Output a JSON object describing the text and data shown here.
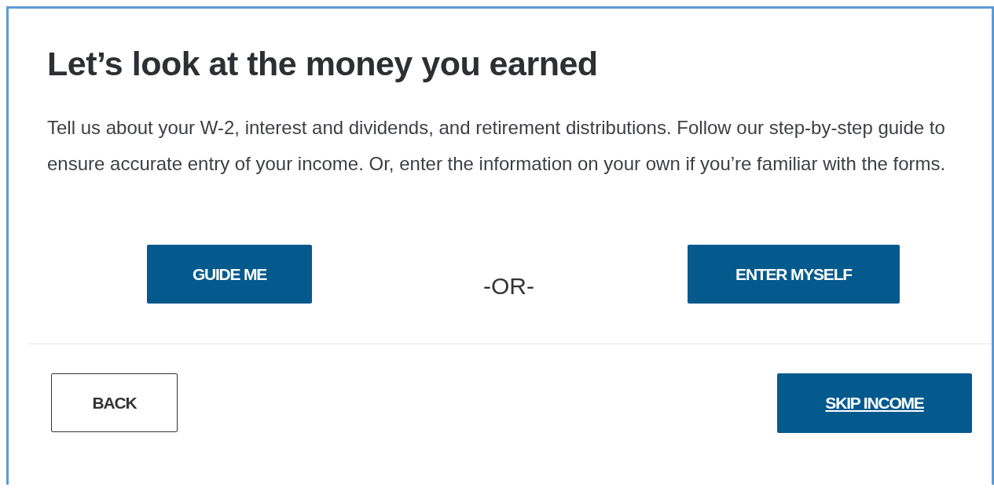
{
  "heading": "Let’s look at the money you earned",
  "intro": "Tell us about your W-2, interest and dividends, and retirement distributions. Follow our step-by-step guide to ensure accurate entry of your income. Or, enter the information on your own if you’re familiar with the forms.",
  "choices": [
    {
      "label": "GUIDE ME"
    },
    {
      "label": "ENTER MYSELF"
    }
  ],
  "separator": "-OR-",
  "footer": [
    {
      "label": "BACK",
      "kind": "secondary"
    },
    {
      "label": "SKIP INCOME",
      "kind": "link"
    }
  ]
}
